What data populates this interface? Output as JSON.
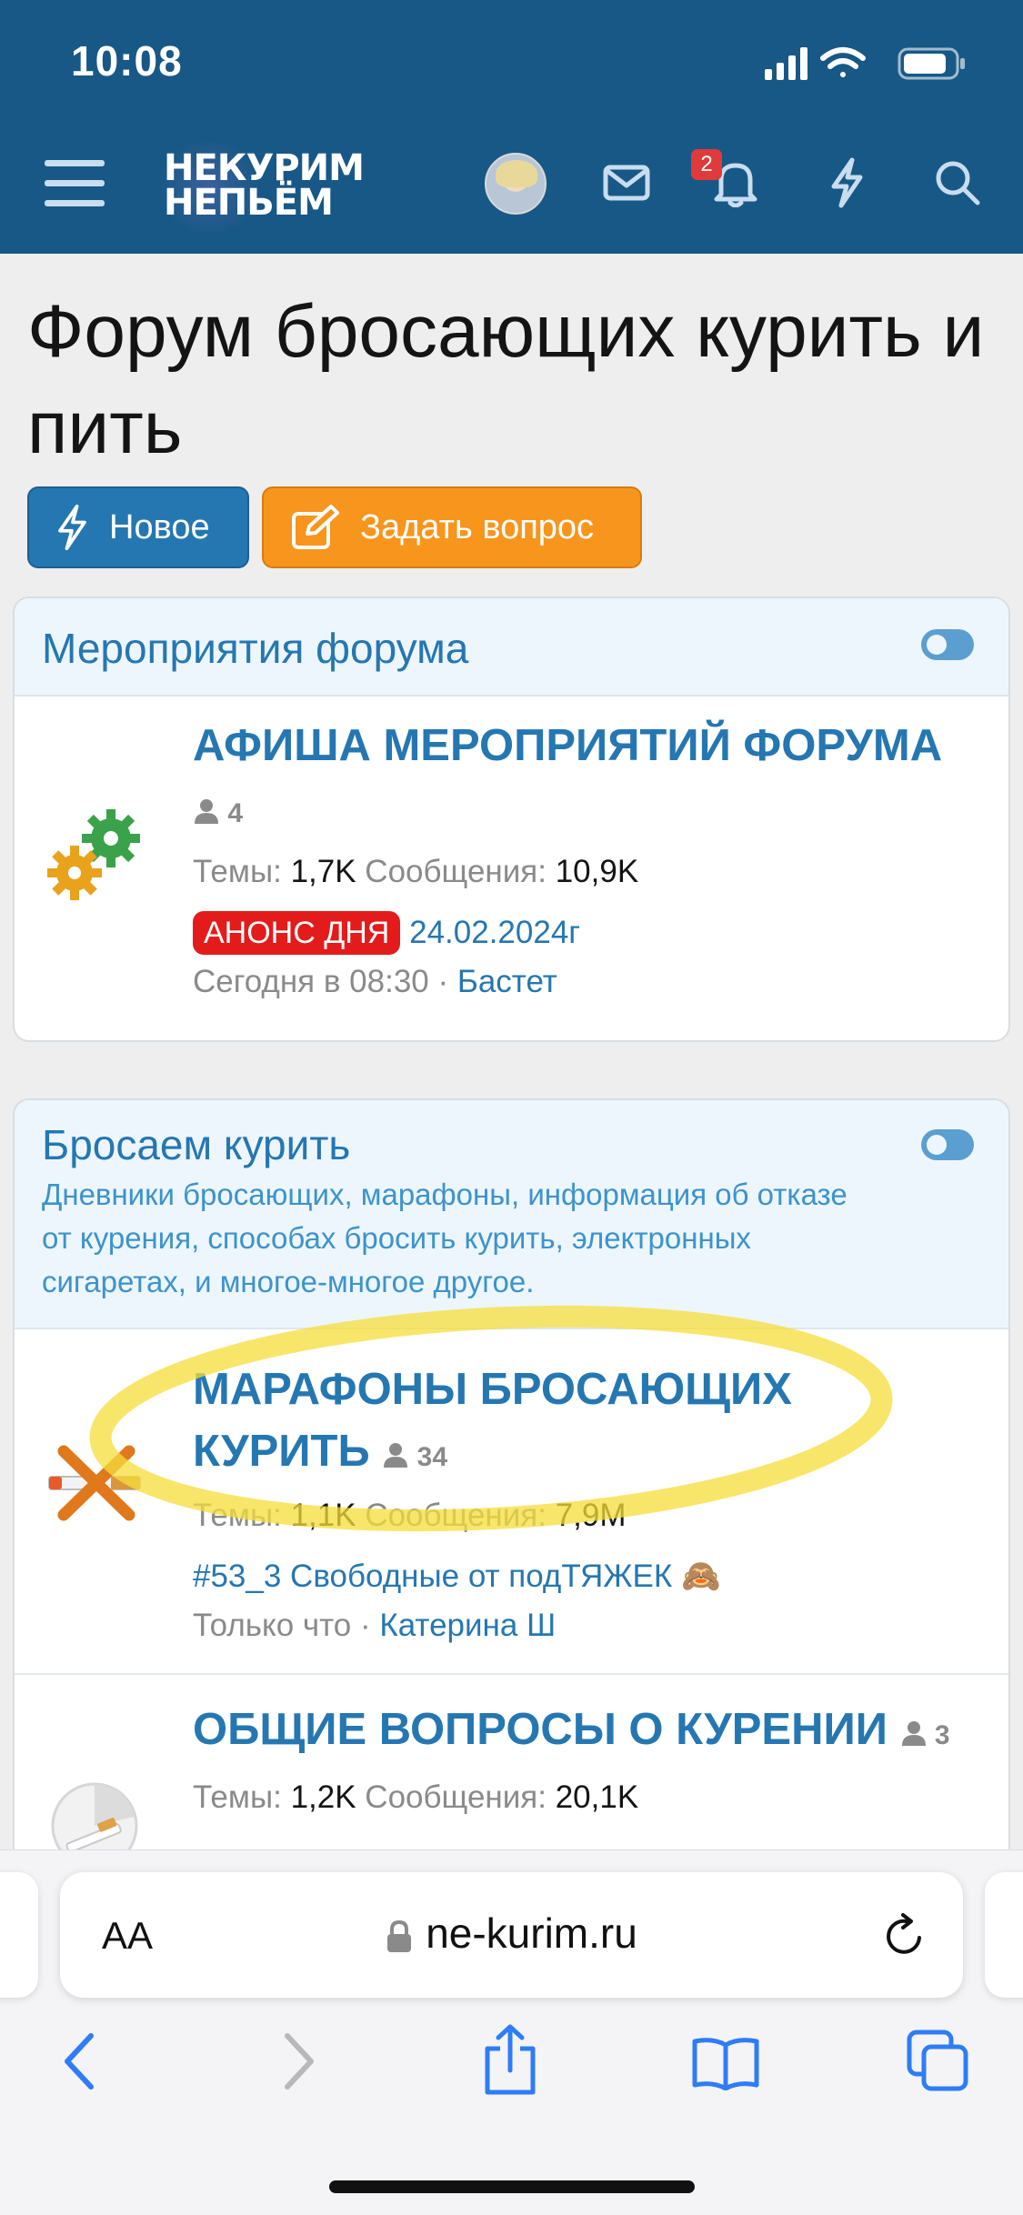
{
  "status": {
    "time": "10:08"
  },
  "header": {
    "logo_line1": "НЕКУРИМ",
    "logo_line2": "НЕПЬЁМ",
    "notification_count": "2",
    "colors": {
      "header_bg": "#185886",
      "badge": "#e03a3a"
    },
    "icons": [
      "menu-icon",
      "avatar",
      "mail-icon",
      "bell-icon",
      "lightning-icon",
      "search-icon"
    ]
  },
  "page": {
    "title": "Форум бросающих курить и пить",
    "new_button": "Новое",
    "ask_button": "Задать вопрос"
  },
  "sections": [
    {
      "title": "Мероприятия форума",
      "description": "",
      "nodes": [
        {
          "title": "АФИША МЕРОПРИЯТИЙ ФОРУМА",
          "members": "4",
          "threads_label": "Темы:",
          "threads": "1,7K",
          "messages_label": "Сообщения:",
          "messages": "10,9K",
          "prefix": "АНОНС ДНЯ",
          "last_thread": "24.02.2024г",
          "last_time": "Сегодня в 08:30",
          "last_user": "Бастет",
          "icon": "gears-icon"
        }
      ]
    },
    {
      "title": "Бросаем курить",
      "description": "Дневники бросающих, марафоны, информация об отказе от курения, способах бросить курить, электронных сигаретах, и многое-многое другое.",
      "nodes": [
        {
          "title": "МАРАФОНЫ БРОСАЮЩИХ КУРИТЬ",
          "members": "34",
          "threads_label": "Темы:",
          "threads": "1,1K",
          "messages_label": "Сообщения:",
          "messages": "7,9M",
          "last_thread": "#53_3 Свободные от подТЯЖЕК 🙈",
          "last_time": "Только что",
          "last_user": "Катерина Ш",
          "icon": "no-smoking-icon"
        },
        {
          "title": "ОБЩИЕ ВОПРОСЫ О КУРЕНИИ",
          "members": "3",
          "threads_label": "Темы:",
          "threads": "1,2K",
          "messages_label": "Сообщения:",
          "messages": "20,1K",
          "icon": "clock-cigarette-icon"
        }
      ]
    }
  ],
  "browser": {
    "text_size": "AA",
    "url": "ne-kurim.ru",
    "icons": [
      "back-icon",
      "forward-icon",
      "share-icon",
      "bookmarks-icon",
      "tabs-icon",
      "reload-icon",
      "lock-icon"
    ]
  }
}
